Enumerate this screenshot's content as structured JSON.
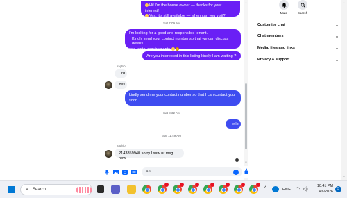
{
  "messages": {
    "top_bubble_line1": "Hi! I'm the house owner — thanks for your interest!",
    "top_bubble_line2": "Yes, it's still available — when can you visit?",
    "stamp1": "Sat 7:09 AM",
    "bubble2_line1": "I'm looking for a good and responsible tenant.",
    "bubble2_line2": "Kindly send your contact number so that we can discuss details",
    "bubble2_line3": "and rental requirements",
    "bubble3": "Are you interested in this listing kindly I am waiting ?",
    "sender1": "raghib",
    "in1": "Urd",
    "in2": "Yes",
    "bubble4": "kindly send me your contact number so that I can contact you soon.",
    "stamp2": "Sat 8:32 AM",
    "bubble5": "Hello",
    "stamp3": "Sat 11:49 AM",
    "sender2": "raghib",
    "in3": "2143859940 sorry I saw ur msg now"
  },
  "composer": {
    "placeholder": "Aa"
  },
  "info_panel": {
    "mute_label": "Mute",
    "search_label": "Search",
    "rows": [
      {
        "label": "Customize chat"
      },
      {
        "label": "Chat members"
      },
      {
        "label": "Media, files and links"
      },
      {
        "label": "Privacy & support"
      }
    ]
  },
  "taskbar": {
    "search_label": "Search",
    "language": "ENG",
    "time": "10:41 PM",
    "date": "4/6/2026",
    "notification_count": "5"
  },
  "colors": {
    "purple_bubble": "#6A1FF5",
    "blue_bubble": "#3E4CF0",
    "accent": "#0866ff"
  },
  "icons": [
    "bell-icon",
    "search-icon",
    "chevron-down-icon",
    "mic-icon",
    "image-icon",
    "sticker-icon",
    "gif-icon",
    "thumbs-up-icon",
    "windows-logo-icon",
    "chrome-icon"
  ]
}
